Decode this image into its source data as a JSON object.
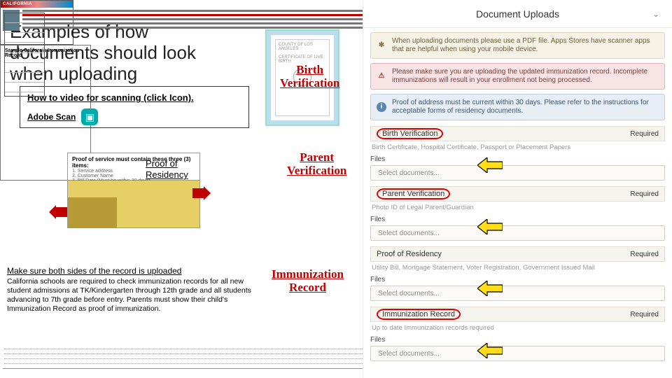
{
  "title": "Examples of how documents should look when uploading",
  "howto": {
    "heading": "How to video for scanning (click Icon).",
    "app": "Adobe Scan",
    "icon_name": "scan-icon"
  },
  "middle_labels": {
    "birth": "Birth\nVerification",
    "parent": "Parent\nVerification",
    "immun": "Immunization\nRecord",
    "por": "Proof of\nResidency"
  },
  "dl_header": "CALIFORNIA",
  "immun_header": "Sample California Immunization Record",
  "por_list_title": "Proof of service must contain these three (3) items:",
  "por_list": [
    "Service address",
    "Customer Name",
    "Bill Date (Must be within 30 days)"
  ],
  "footnote": {
    "lead": "Make sure both sides of the record is uploaded",
    "body": "California schools are required to check immunization records for all new student admissions at TK/Kindergarten through 12th grade and all students advancing to 7th grade before entry. Parents must show their child's Immunization Record as proof of immunization."
  },
  "panel": {
    "title": "Document Uploads",
    "alerts": {
      "warn": "When uploading documents please use a PDF file. Apps Stores have scanner apps that are helpful when using your mobile device.",
      "danger": "Please make sure you are uploading the updated immunization record. Incomplete immunizations will result in your enrollment not being processed.",
      "info": "Proof of address must be current within 30 days. Please refer to the instructions for acceptable forms of residency documents."
    },
    "required_label": "Required",
    "files_label": "Files",
    "select_label": "Select documents...",
    "sections": [
      {
        "title": "Birth Verification",
        "sub": "Birth Certificate, Hospital Certificate, Passport or Placement Papers",
        "circled": true
      },
      {
        "title": "Parent Verification",
        "sub": "Photo ID of Legal Parent/Guardian",
        "circled": true
      },
      {
        "title": "Proof of Residency",
        "sub": "Utility Bill, Mortgage Statement, Voter Registration, Government Issued Mail",
        "circled": false
      },
      {
        "title": "Immunization Record",
        "sub": "Up to date Immunization records required",
        "circled": true
      }
    ]
  }
}
